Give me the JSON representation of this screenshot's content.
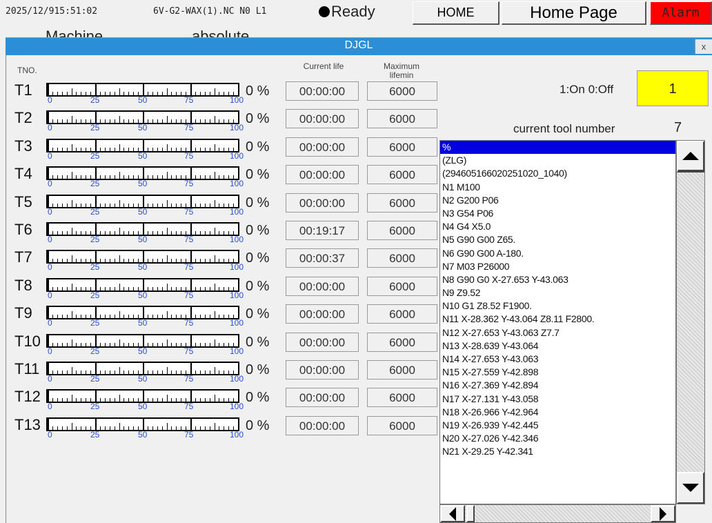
{
  "topbar": {
    "datetime": "2025/12/915:51:02",
    "program": "6V-G2-WAX(1).NC N0 L1",
    "status": "Ready",
    "home_btn": "HOME",
    "home_page": "Home Page",
    "alarm": "Alarm",
    "under_left": "Machine",
    "under_right": "absolute"
  },
  "dialog": {
    "title": "DJGL",
    "close": "x",
    "tno_header": "TNO.",
    "current_life_header": "Current life",
    "max_life_header": "Maximum lifemin"
  },
  "gauge_ticks": [
    "0",
    "25",
    "50",
    "75",
    "100"
  ],
  "tools": [
    {
      "label": "T1",
      "percent": "0 %",
      "life": "00:00:00",
      "max": "6000"
    },
    {
      "label": "T2",
      "percent": "0 %",
      "life": "00:00:00",
      "max": "6000"
    },
    {
      "label": "T3",
      "percent": "0 %",
      "life": "00:00:00",
      "max": "6000"
    },
    {
      "label": "T4",
      "percent": "0 %",
      "life": "00:00:00",
      "max": "6000"
    },
    {
      "label": "T5",
      "percent": "0 %",
      "life": "00:00:00",
      "max": "6000"
    },
    {
      "label": "T6",
      "percent": "0 %",
      "life": "00:19:17",
      "max": "6000"
    },
    {
      "label": "T7",
      "percent": "0 %",
      "life": "00:00:37",
      "max": "6000"
    },
    {
      "label": "T8",
      "percent": "0 %",
      "life": "00:00:00",
      "max": "6000"
    },
    {
      "label": "T9",
      "percent": "0 %",
      "life": "00:00:00",
      "max": "6000"
    },
    {
      "label": "T10",
      "percent": "0 %",
      "life": "00:00:00",
      "max": "6000"
    },
    {
      "label": "T11",
      "percent": "0 %",
      "life": "00:00:00",
      "max": "6000"
    },
    {
      "label": "T12",
      "percent": "0 %",
      "life": "00:00:00",
      "max": "6000"
    },
    {
      "label": "T13",
      "percent": "0 %",
      "life": "00:00:00",
      "max": "6000"
    }
  ],
  "onoff": {
    "label": "1:On 0:Off",
    "value": "1"
  },
  "current_tool": {
    "label": "current tool number",
    "value": "7"
  },
  "program_lines": [
    "%",
    "(ZLG)",
    "(294605166020251020_1040)",
    "N1 M100",
    "N2 G200 P06",
    "N3 G54 P06",
    "N4 G4 X5.0",
    "N5 G90 G00 Z65.",
    "N6 G90 G00  A-180.",
    "N7 M03 P26000",
    "N8 G90 G0 X-27.653 Y-43.063",
    "N9 Z9.52",
    "N10 G1 Z8.52 F1900.",
    "N11 X-28.362 Y-43.064 Z8.11 F2800.",
    "N12 X-27.653 Y-43.063 Z7.7",
    "N13 X-28.639 Y-43.064",
    "N14 X-27.653 Y-43.063",
    "N15 X-27.559 Y-42.898",
    "N16 X-27.369 Y-42.894",
    "N17 X-27.131 Y-43.058",
    "N18 X-26.966 Y-42.964",
    "N19 X-26.939 Y-42.445",
    "N20 X-27.026 Y-42.346",
    "N21 X-29.25 Y-42.341"
  ],
  "selected_line_index": 0,
  "colors": {
    "titlebar": "#2c8ed6",
    "alarm": "#ff0000",
    "onoff": "#ffff00",
    "selection": "#0000e0",
    "gauge_numbers": "#2a4fd0"
  }
}
